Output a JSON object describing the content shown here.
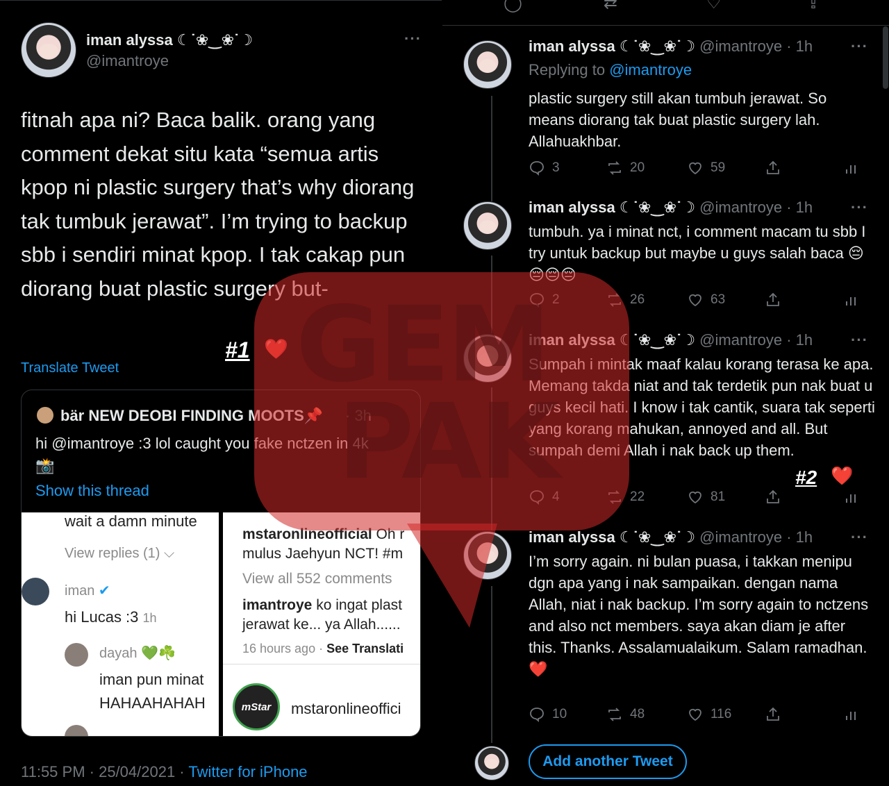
{
  "colors": {
    "accent": "#1d9bf0",
    "background": "#000000",
    "muted": "#71767b",
    "heart": "#e0245e"
  },
  "main_tweet": {
    "author_name": "iman alyssa ☾˙❀‿❀˙☽",
    "author_handle": "@imantroye",
    "more": "···",
    "text": "fitnah apa ni? Baca balik. orang yang comment dekat situ kata “semua artis kpop ni plastic surgery that’s why diorang tak tumbuk jerawat”. I’m trying to backup sbb i sendiri minat kpop. I tak cakap pun diorang buat plastic surgery but-",
    "annotation_tag": "#1",
    "annotation_heart": "❤️",
    "translate_label": "Translate Tweet",
    "quoted": {
      "author": "bär NEW DEOBI FINDING MOOTS📌",
      "time": "· 3h",
      "text": "hi @imantroye :3 lol caught you fake nctzen in 4k",
      "emoji": "📸",
      "show_thread": "Show this thread",
      "screenshot_a": {
        "line1": "wait a damn minute",
        "view_replies": "View replies (1) ⌵",
        "commenter": "iman",
        "comment": "hi Lucas :3",
        "comment_time": "1h",
        "commenter2": "dayah 💚☘️",
        "comment2a": "iman pun minat",
        "comment2b": "HAHAAHAHAH"
      },
      "screenshot_b": {
        "caption_user": "mstaronlineofficial",
        "caption_rest": "Oh r",
        "caption_line2": "mulus Jaehyun NCT! #m",
        "view_all": "View all 552 comments",
        "reply_user": "imantroye",
        "reply_text": "ko ingat plast",
        "reply_line2": "jerawat ke... ya Allah......",
        "time_ago": "16 hours ago",
        "see_translation": "See Translati",
        "logo_text": "mStar",
        "account": "mstaronlineoffici"
      }
    },
    "timestamp": "11:55 PM · 25/04/2021 · ",
    "source": "Twitter for iPhone"
  },
  "thread": [
    {
      "name": "iman alyssa ☾˙❀‿❀˙☽",
      "handle": "@imantroye · 1h",
      "replying_prefix": "Replying to ",
      "replying_to": "@imantroye",
      "text": "plastic surgery still akan tumbuh jerawat. So means diorang tak buat plastic surgery lah. Allahuakhbar.",
      "replies": "3",
      "retweets": "20",
      "likes": "59"
    },
    {
      "name": "iman alyssa ☾˙❀‿❀˙☽",
      "handle": "@imantroye · 1h",
      "text": "tumbuh. ya i minat nct, i comment macam tu sbb I try untuk backup but maybe u guys salah baca 😔😔😔😔",
      "replies": "2",
      "retweets": "26",
      "likes": "63"
    },
    {
      "name": "iman alyssa ☾˙❀‿❀˙☽",
      "handle": "@imantroye · 1h",
      "text": "Sumpah i mintak maaf kalau korang terasa ke apa. Memang takda niat and tak terdetik pun nak buat u guys kecil hati. I know i tak cantik, suara tak seperti yang korang mahukan, annoyed and all. But sumpah demi Allah i nak back up them.",
      "replies": "4",
      "retweets": "22",
      "likes": "81",
      "annotation_tag": "#2",
      "annotation_heart": "❤️"
    },
    {
      "name": "iman alyssa ☾˙❀‿❀˙☽",
      "handle": "@imantroye · 1h",
      "text": "I’m sorry again. ni bulan puasa, i takkan menipu dgn apa yang i nak sampaikan. dengan nama Allah, niat i nak backup. I’m sorry again to nctzens and also nct members. saya akan diam je after this. Thanks. Assalamualaikum. Salam ramadhan. ❤️",
      "replies": "10",
      "retweets": "48",
      "likes": "116"
    }
  ],
  "add_tweet_label": "Add another Tweet",
  "watermark": {
    "line1": "GEM",
    "line2": "PAK"
  },
  "icons": [
    "reply-icon",
    "retweet-icon",
    "like-icon",
    "share-icon",
    "analytics-icon",
    "more-icon"
  ]
}
